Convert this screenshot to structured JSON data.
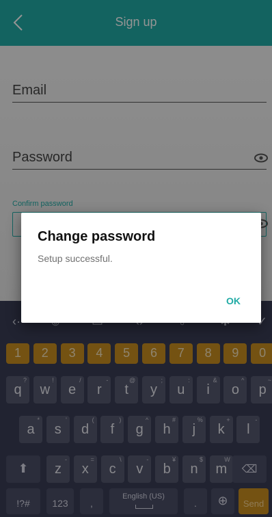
{
  "header": {
    "title": "Sign up"
  },
  "form": {
    "email_label": "Email",
    "password_label": "Password",
    "confirm_label": "Confirm password"
  },
  "keyboard": {
    "numbers": [
      "1",
      "2",
      "3",
      "4",
      "5",
      "6",
      "7",
      "8",
      "9",
      "0"
    ],
    "row1": [
      {
        "k": "q",
        "h": "?"
      },
      {
        "k": "w",
        "h": "!"
      },
      {
        "k": "e",
        "h": "/"
      },
      {
        "k": "r",
        "h": "-"
      },
      {
        "k": "t",
        "h": "@"
      },
      {
        "k": "y",
        "h": ";"
      },
      {
        "k": "u",
        "h": ":"
      },
      {
        "k": "i",
        "h": "&"
      },
      {
        "k": "o",
        "h": "^"
      },
      {
        "k": "p",
        "h": "~"
      }
    ],
    "row2": [
      {
        "k": "a",
        "h": "*"
      },
      {
        "k": "s",
        "h": "'"
      },
      {
        "k": "d",
        "h": "("
      },
      {
        "k": "f",
        "h": ")"
      },
      {
        "k": "g",
        "h": "^"
      },
      {
        "k": "h",
        "h": "#"
      },
      {
        "k": "j",
        "h": "%"
      },
      {
        "k": "k",
        "h": "+"
      },
      {
        "k": "l",
        "h": "-"
      }
    ],
    "row3": [
      {
        "k": "z",
        "h": "-"
      },
      {
        "k": "x",
        "h": "="
      },
      {
        "k": "c",
        "h": "\\"
      },
      {
        "k": "v",
        "h": "-"
      },
      {
        "k": "b",
        "h": "¥"
      },
      {
        "k": "n",
        "h": "$"
      },
      {
        "k": "m",
        "h": "W"
      }
    ],
    "symbols_label": "!?#",
    "numpad_label": "123",
    "comma": ",",
    "space_label": "English (US)",
    "period": ".",
    "send_label": "Send"
  },
  "dialog": {
    "title": "Change password",
    "message": "Setup successful.",
    "ok_label": "OK"
  },
  "colors": {
    "accent": "#21aba5",
    "keyboard_bg": "#3a3d55",
    "number_key": "#c98e20"
  }
}
